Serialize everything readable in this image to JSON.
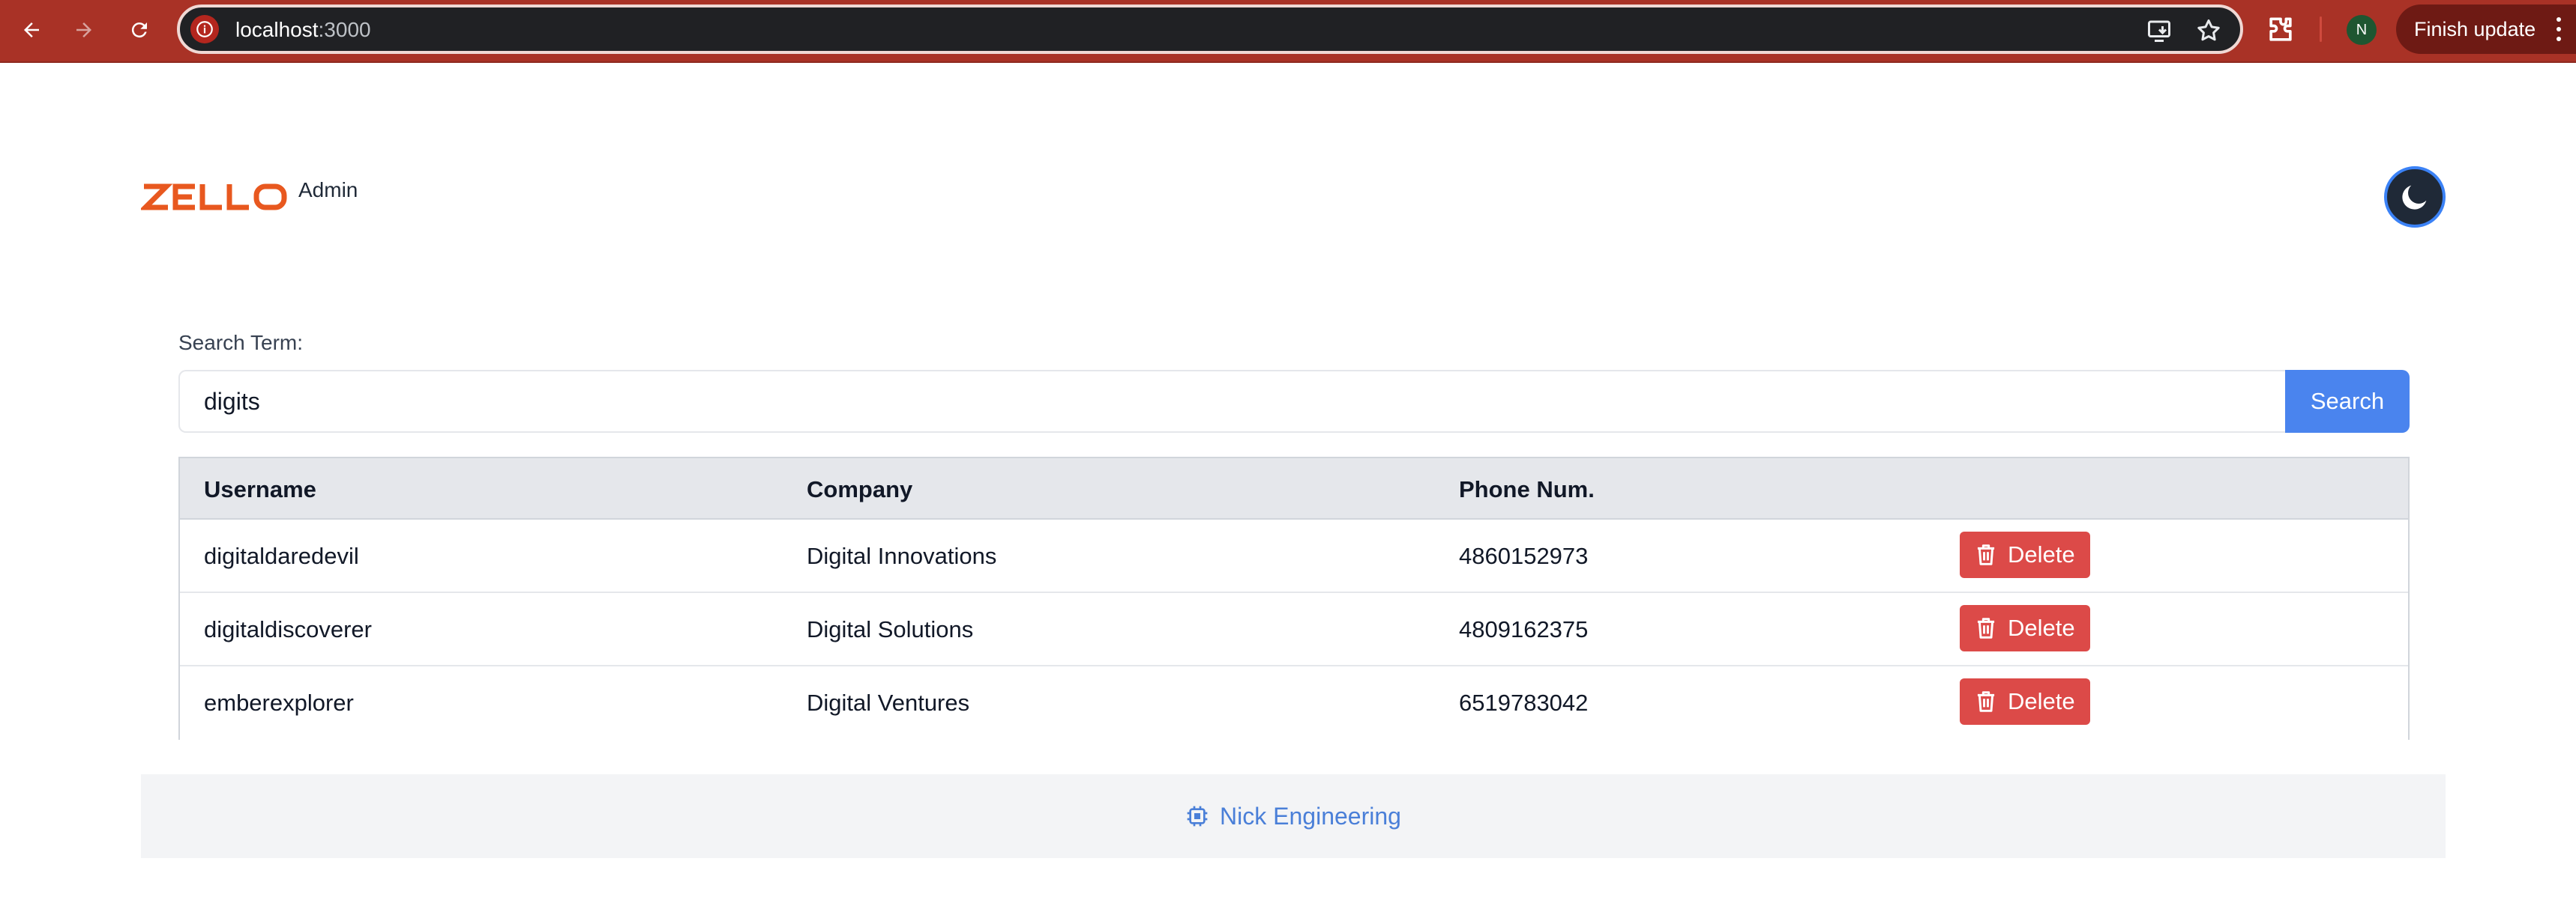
{
  "browser": {
    "url_host": "localhost",
    "url_port": ":3000",
    "profile_initial": "N",
    "finish_update_label": "Finish update"
  },
  "header": {
    "logo_text": "ZELLO",
    "admin_label": "Admin"
  },
  "search": {
    "label": "Search Term:",
    "value": "digits",
    "button_label": "Search"
  },
  "table": {
    "columns": [
      "Username",
      "Company",
      "Phone Num."
    ],
    "rows": [
      {
        "username": "digitaldaredevil",
        "company": "Digital Innovations",
        "phone": "4860152973",
        "action": "Delete"
      },
      {
        "username": "digitaldiscoverer",
        "company": "Digital Solutions",
        "phone": "4809162375",
        "action": "Delete"
      },
      {
        "username": "emberexplorer",
        "company": "Digital Ventures",
        "phone": "6519783042",
        "action": "Delete"
      }
    ]
  },
  "footer": {
    "credit": "Nick Engineering"
  },
  "colors": {
    "brand_orange": "#e8581f",
    "primary_blue": "#4a84ee",
    "danger_red": "#dc4a48",
    "browser_frame": "#a93226"
  }
}
